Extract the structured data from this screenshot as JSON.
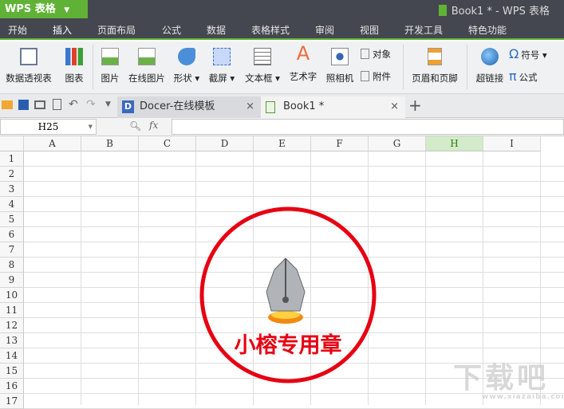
{
  "app": {
    "button": "WPS 表格",
    "title": "Book1 * - WPS 表格"
  },
  "menu": [
    "开始",
    "插入",
    "页面布局",
    "公式",
    "数据",
    "表格样式",
    "审阅",
    "视图",
    "开发工具",
    "特色功能"
  ],
  "ribbon": {
    "pivot": "数据透视表",
    "chart": "图表",
    "picture": "图片",
    "online_picture": "在线图片",
    "shape": "形状",
    "screenshot": "截屏",
    "textbox": "文本框",
    "wordart": "艺术字",
    "camera": "照相机",
    "object": "对象",
    "attachment": "附件",
    "header_footer": "页眉和页脚",
    "hyperlink": "超链接",
    "symbol": "符号",
    "formula": "公式"
  },
  "tabs": [
    {
      "label": "Docer-在线模板"
    },
    {
      "label": "Book1 *"
    }
  ],
  "formula": {
    "cell_ref": "H25",
    "fx": "fx",
    "value": ""
  },
  "columns": [
    "A",
    "B",
    "C",
    "D",
    "E",
    "F",
    "G",
    "H",
    "I"
  ],
  "rows": [
    "1",
    "2",
    "3",
    "4",
    "5",
    "6",
    "7",
    "8",
    "9",
    "10",
    "11",
    "12",
    "13",
    "14",
    "15",
    "16",
    "17"
  ],
  "selected_column": "H",
  "seal": {
    "text": "小榕专用章",
    "color": "#e60012"
  },
  "watermark": {
    "text": "下载吧",
    "url": "www.xiazaiba.com"
  },
  "colors": {
    "accent": "#5fb236",
    "titlebar": "#44474f"
  }
}
